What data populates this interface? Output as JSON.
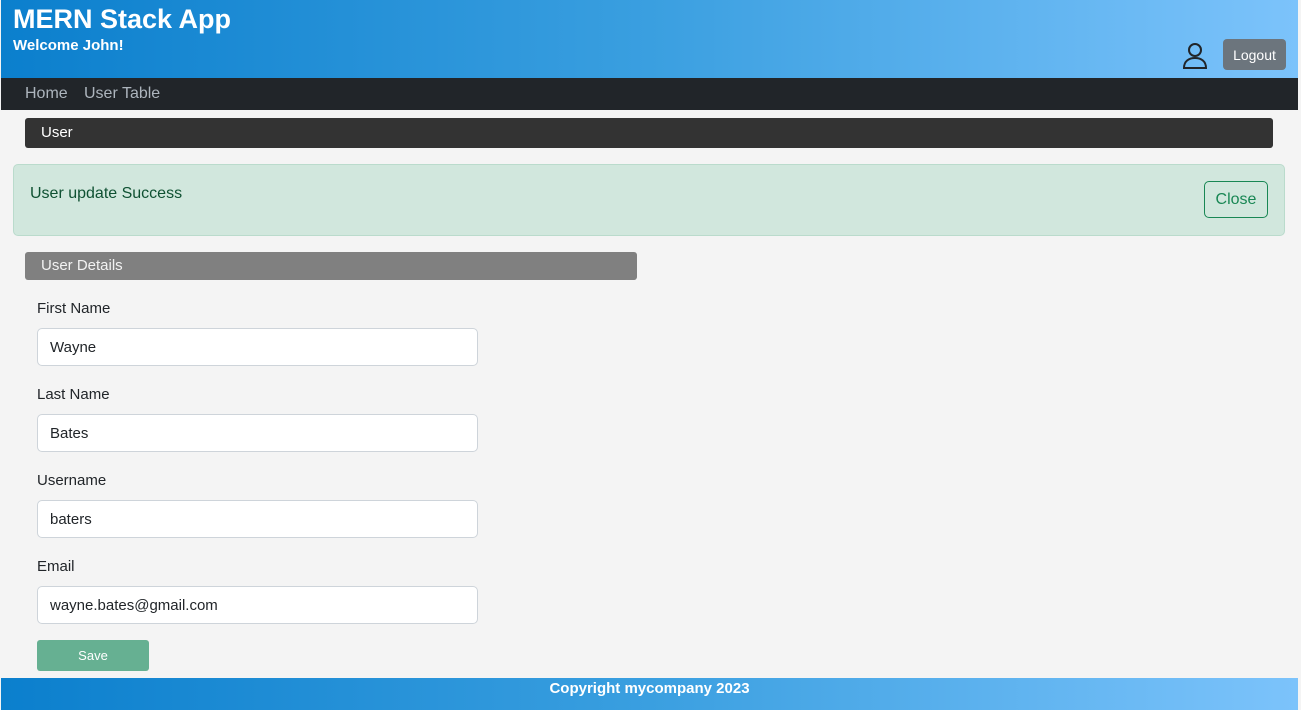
{
  "header": {
    "app_title": "MERN Stack App",
    "welcome": "Welcome John!",
    "user_icon": "user-icon",
    "logout_label": "Logout"
  },
  "nav": {
    "items": [
      {
        "label": "Home"
      },
      {
        "label": "User Table"
      }
    ]
  },
  "section": {
    "title": "User"
  },
  "alert": {
    "message": "User update Success",
    "close_label": "Close",
    "color": "#d1e7dd"
  },
  "details": {
    "title": "User Details",
    "fields": [
      {
        "label": "First Name",
        "value": "Wayne"
      },
      {
        "label": "Last Name",
        "value": "Bates"
      },
      {
        "label": "Username",
        "value": "baters"
      },
      {
        "label": "Email",
        "value": "wayne.bates@gmail.com"
      }
    ],
    "save_label": "Save"
  },
  "footer": {
    "text": "Copyright mycompany 2023"
  },
  "colors": {
    "header_gradient_start": "#0b7fcd",
    "header_gradient_end": "#7cc3fb",
    "navbar": "#212529",
    "save_button": "#66b092"
  }
}
